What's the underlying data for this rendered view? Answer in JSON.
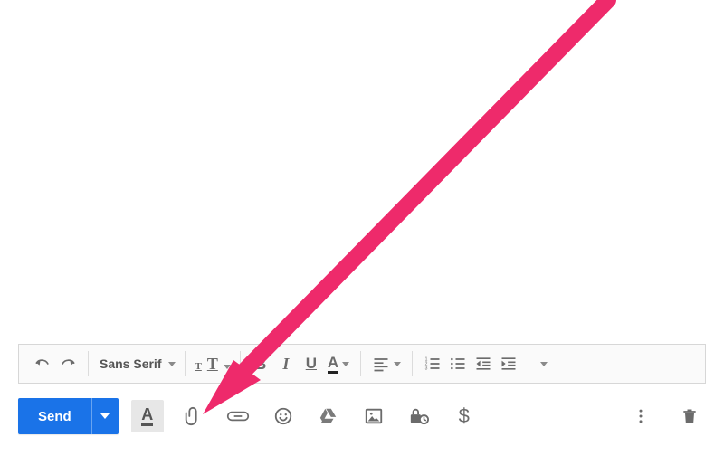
{
  "composeArea": {
    "content": ""
  },
  "formatToolbar": {
    "font_family_label": "Sans Serif",
    "bold_label": "B",
    "italic_label": "I",
    "underline_label": "U",
    "textcolor_label": "A",
    "textsize_small_label": "T",
    "textsize_large_label": "T"
  },
  "actionBar": {
    "send_label": "Send",
    "formatting_toggle_label": "A",
    "money_label": "$"
  },
  "annotation": {
    "color": "#ee2a6b",
    "target": "attach-file-button"
  }
}
